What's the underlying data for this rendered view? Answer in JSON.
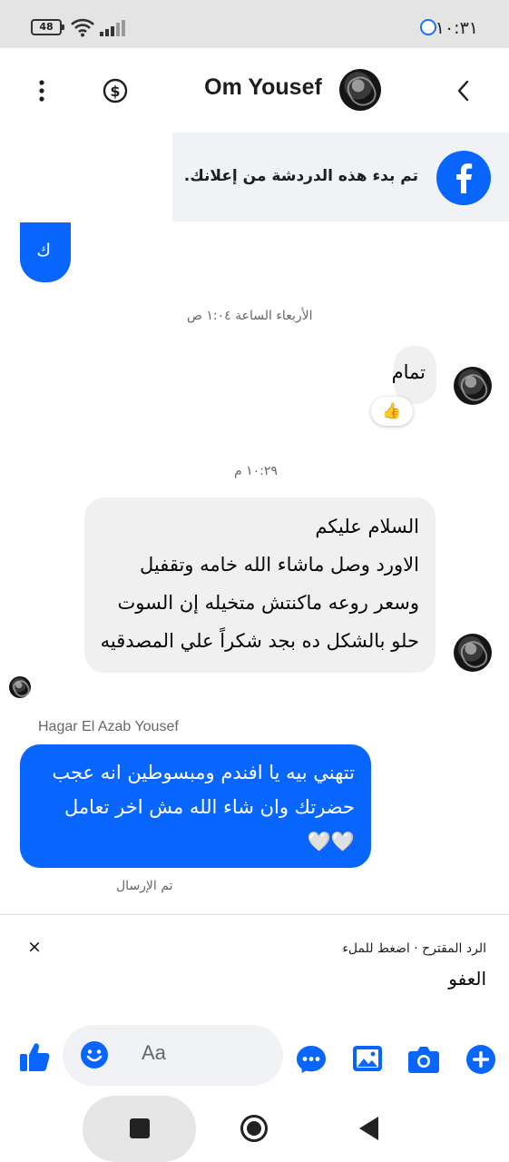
{
  "status_bar": {
    "battery": "48",
    "time": "١٠:٣١"
  },
  "header": {
    "contact_name": "Om Yousef"
  },
  "ad_banner": {
    "text": "تم بدء هذه الدردشة من إعلانك."
  },
  "messages": {
    "partial_outgoing": "ك",
    "timestamp_1": "الأربعاء الساعة ١:٠٤ ص",
    "incoming_1": "تمام",
    "incoming_1_reaction": "👍",
    "timestamp_2": "١٠:٢٩ م",
    "incoming_2_lines": [
      "السلام عليكم",
      "الاورد  وصل ماشاء الله خامه وتقفيل",
      "وسعر روعه ماكنتش متخيله إن السوت",
      "حلو بالشكل ده بجد شكراً علي المصدقيه"
    ],
    "sender_name": "Hagar El Azab Yousef",
    "outgoing_lines": [
      "تتهني بيه يا افندم ومبسوطين انه عجب",
      "حضرتك وان شاء الله مش اخر تعامل",
      "🤍🤍"
    ],
    "sent_status": "تم الإرسال"
  },
  "suggested_reply": {
    "hint": "الرد المقترح · اضغط للملء",
    "reply": "العفو",
    "close": "×"
  },
  "composer": {
    "placeholder": "Aa"
  },
  "colors": {
    "messenger_blue": "#0866FF",
    "incoming_bubble": "#F0F0F0",
    "muted_text": "#65676B"
  },
  "icons": {
    "more": "more-vertical-icon",
    "payment": "dollar-circle-icon",
    "back": "chevron-right-icon",
    "facebook": "facebook-logo-icon",
    "like": "thumbs-up-icon",
    "emoji": "emoji-icon",
    "chat_extensions": "chat-extensions-icon",
    "gallery": "gallery-icon",
    "camera": "camera-icon",
    "add": "plus-circle-icon",
    "nav_recents": "nav-recents-icon",
    "nav_home": "nav-home-icon",
    "nav_back": "nav-back-icon"
  }
}
